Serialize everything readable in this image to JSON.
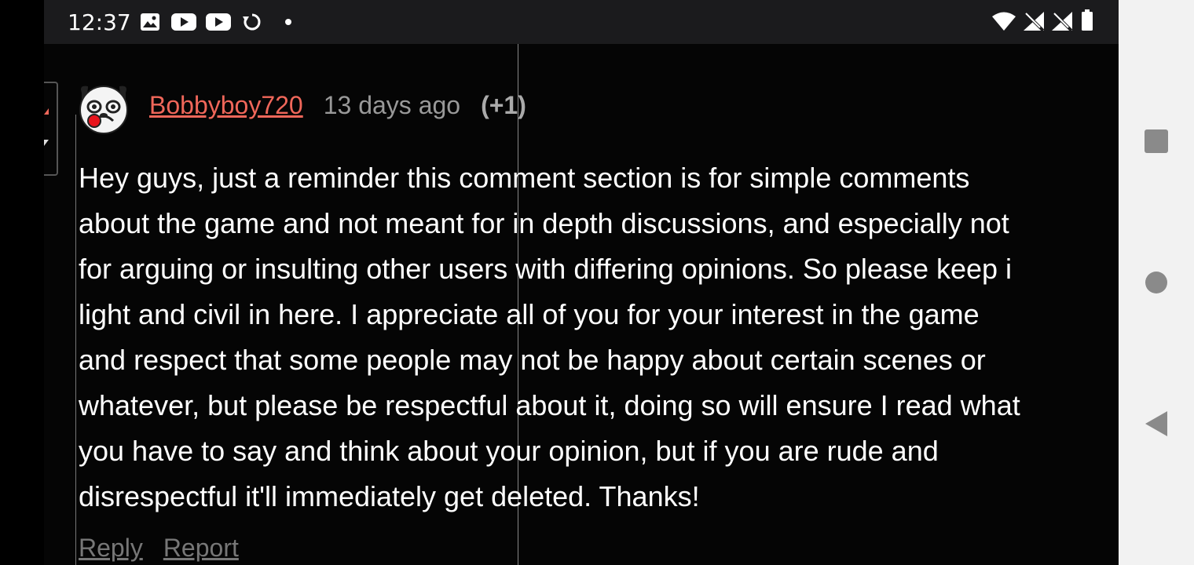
{
  "status_bar": {
    "time": "12:37",
    "left_icons": [
      "image-icon",
      "youtube-icon",
      "youtube-icon",
      "sync-icon",
      "dot-icon"
    ],
    "right_icons": [
      "wifi-icon",
      "no-signal-icon",
      "no-signal-icon",
      "battery-icon"
    ]
  },
  "comment": {
    "username": "Bobbyboy720",
    "time_ago": "13 days ago",
    "score": "(+1)",
    "avatar": "pug-avatar",
    "body_lines": [
      "Hey guys, just a reminder this comment section is for simple comments",
      "about the game and not meant for in depth discussions, and especially not",
      "for arguing or insulting other users with differing opinions. So please keep i",
      "light and civil in here. I appreciate all of you for your interest in the game",
      "and respect that some people may not be happy about certain scenes or",
      "whatever, but please be respectful about it, doing so will ensure I read what",
      "you have to say and think about your opinion, but if you are rude and",
      "disrespectful it'll immediately get deleted. Thanks!"
    ],
    "actions": {
      "reply": "Reply",
      "report": "Report"
    }
  },
  "nav_bar": {
    "buttons": [
      "recents-square-icon",
      "home-circle-icon",
      "back-triangle-icon"
    ]
  },
  "colors": {
    "username": "#f0675a",
    "background": "#050505",
    "status_bar": "#1b1b1d",
    "nav_bar": "#f2f2f2"
  }
}
